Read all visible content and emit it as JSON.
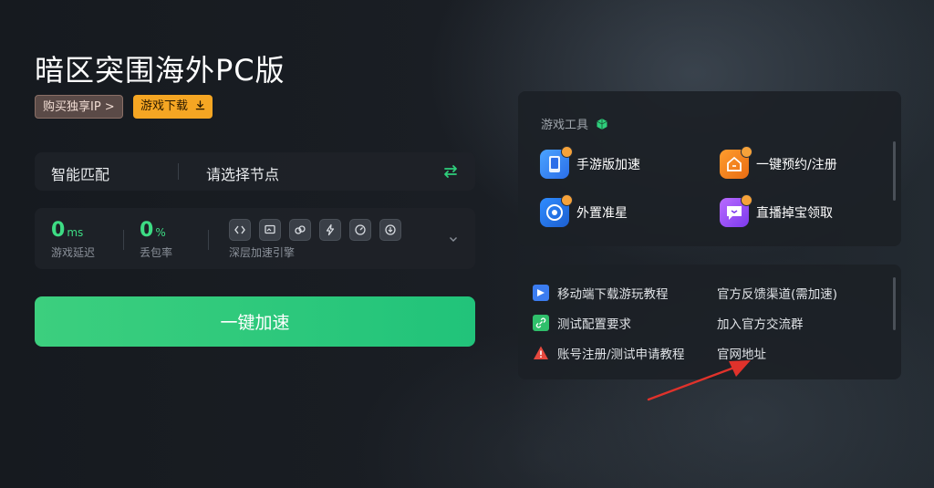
{
  "header": {
    "title": "暗区突围海外PC版",
    "buy_ip_label": "购买独享IP >",
    "download_label": "游戏下载"
  },
  "node_bar": {
    "mode_label": "智能匹配",
    "node_label": "请选择节点"
  },
  "stats": {
    "latency_value": "0",
    "latency_unit": "ms",
    "latency_label": "游戏延迟",
    "loss_value": "0",
    "loss_unit": "%",
    "loss_label": "丢包率",
    "engine_label": "深层加速引擎"
  },
  "accelerate_label": "一键加速",
  "tools": {
    "heading": "游戏工具",
    "items": [
      {
        "label": "手游版加速",
        "icon": "mobile-accel-icon"
      },
      {
        "label": "一键预约/注册",
        "icon": "reserve-register-icon"
      },
      {
        "label": "外置准星",
        "icon": "crosshair-icon"
      },
      {
        "label": "直播掉宝领取",
        "icon": "live-drops-icon"
      }
    ]
  },
  "links": {
    "left": [
      {
        "label": "移动端下载游玩教程",
        "icon": "mobile-tutorial-icon"
      },
      {
        "label": "测试配置要求",
        "icon": "link-icon"
      },
      {
        "label": "账号注册/测试申请教程",
        "icon": "warning-icon"
      }
    ],
    "right": [
      {
        "label": "官方反馈渠道(需加速)"
      },
      {
        "label": "加入官方交流群"
      },
      {
        "label": "官网地址"
      }
    ]
  },
  "colors": {
    "accent_green": "#2fcf7c",
    "download_orange": "#f5a623",
    "stat_green": "#3ddc84",
    "arrow_red": "#e0322b"
  }
}
